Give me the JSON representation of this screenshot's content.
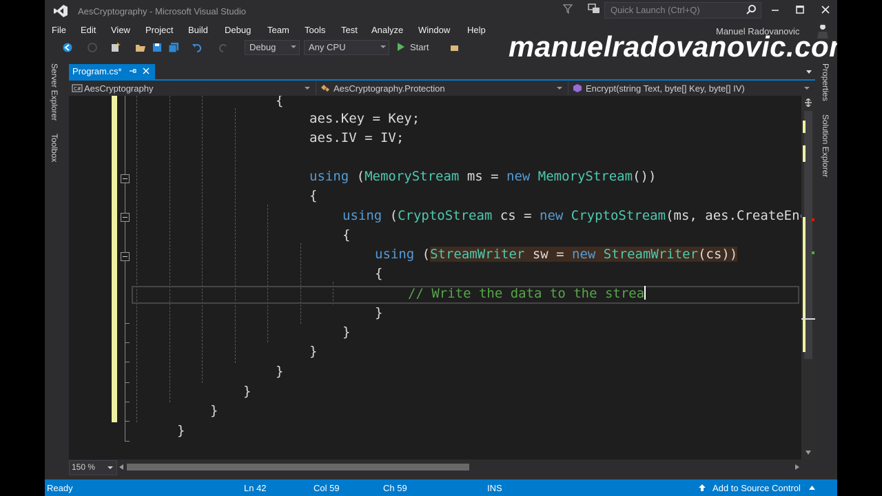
{
  "window": {
    "title": "AesCryptography - Microsoft Visual Studio",
    "quick_launch_placeholder": "Quick Launch (Ctrl+Q)",
    "user_name": "Manuel Radovanovic"
  },
  "menu": [
    "File",
    "Edit",
    "View",
    "Project",
    "Build",
    "Debug",
    "Team",
    "Tools",
    "Test",
    "Analyze",
    "Window",
    "Help"
  ],
  "toolbar": {
    "config": "Debug",
    "platform": "Any CPU",
    "start_label": "Start"
  },
  "side_tabs": {
    "left": [
      "Server Explorer",
      "Toolbox"
    ],
    "right": [
      "Properties",
      "Solution Explorer"
    ]
  },
  "document_tab": {
    "label": "Program.cs*"
  },
  "navbar": {
    "project": "AesCryptography",
    "type": "AesCryptography.Protection",
    "member": "Encrypt(string Text, byte[] Key, byte[] IV)"
  },
  "code": {
    "l1": "{",
    "l2a": "aes.Key = Key;",
    "l3a": "aes.IV = IV;",
    "l5_kw": "using",
    "l5_p1": " (",
    "l5_t1": "MemoryStream",
    "l5_p2": " ms = ",
    "l5_kw2": "new",
    "l5_p3": " ",
    "l5_t2": "MemoryStream",
    "l5_p4": "())",
    "l6": "{",
    "l7_kw": "using",
    "l7_p1": " (",
    "l7_t1": "CryptoStream",
    "l7_p2": " cs = ",
    "l7_kw2": "new",
    "l7_p3": " ",
    "l7_t2": "CryptoStream",
    "l7_p4": "(ms, aes.CreateEncryp",
    "l8": "{",
    "l9_kw": "using",
    "l9_p1": " (",
    "l9_t1": "StreamWriter",
    "l9_p2": " sw = ",
    "l9_kw2": "new",
    "l9_p3": " ",
    "l9_t2": "StreamWriter",
    "l9_p4": "(cs))",
    "l10": "{",
    "l11": "// Write the data to the strea",
    "c12": "}",
    "c13": "}",
    "c14": "}",
    "c15": "}",
    "c16": "}",
    "c17": "}",
    "c18": "}"
  },
  "zoom": "150 %",
  "status": {
    "state": "Ready",
    "ln": "Ln 42",
    "col": "Col 59",
    "ch": "Ch 59",
    "mode": "INS",
    "source_control": "Add to Source Control"
  },
  "watermark": "manuelradovanovic.com",
  "colors": {
    "accent": "#007acc",
    "keyword": "#569cd6",
    "type": "#4ec9b0",
    "comment": "#57a64a",
    "change_bar": "#eff0a1"
  }
}
